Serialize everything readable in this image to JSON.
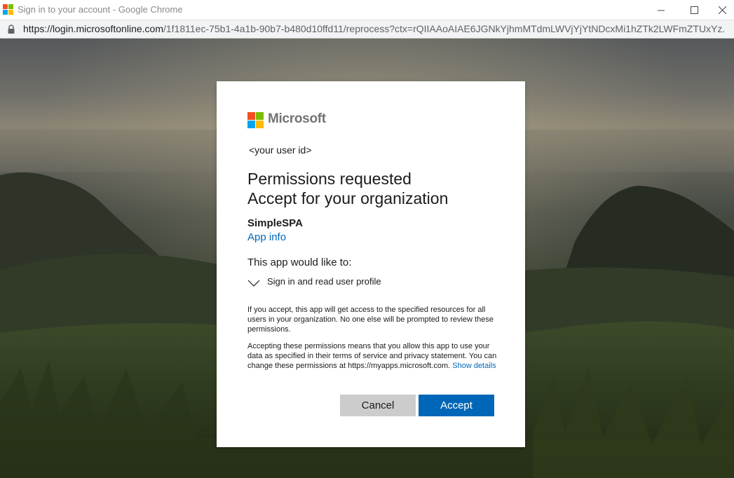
{
  "window": {
    "title": "Sign in to your account - Google Chrome"
  },
  "address_bar": {
    "url_host": "https://login.microsoftonline.com",
    "url_path": "/1f1811ec-75b1-4a1b-90b7-b480d10ffd11/reprocess?ctx=rQIIAAoAIAE6JGNkYjhmMTdmLWVjYjYtNDcxMi1hZTk2LWFmZTUxYz..."
  },
  "brand": {
    "name": "Microsoft",
    "logo_colors": [
      "#f25022",
      "#7fba00",
      "#00a4ef",
      "#ffb900"
    ]
  },
  "dialog": {
    "user_id": "<your user id>",
    "heading_line1": "Permissions requested",
    "heading_line2": "Accept for your organization",
    "app_name": "SimpleSPA",
    "app_info_link": "App info",
    "would_like": "This app would like to:",
    "permission_item": "Sign in and read user profile",
    "paragraph1": "If you accept, this app will get access to the specified resources for all users in your organization. No one else will be prompted to review these permissions.",
    "paragraph2": "Accepting these permissions means that you allow this app to use your data as specified in their terms of service and privacy statement. You can change these permissions at https://myapps.microsoft.com.",
    "show_details_link": "Show details",
    "cancel_label": "Cancel",
    "accept_label": "Accept"
  },
  "colors": {
    "accent": "#0067b8",
    "cancel_bg": "#cccccc"
  }
}
